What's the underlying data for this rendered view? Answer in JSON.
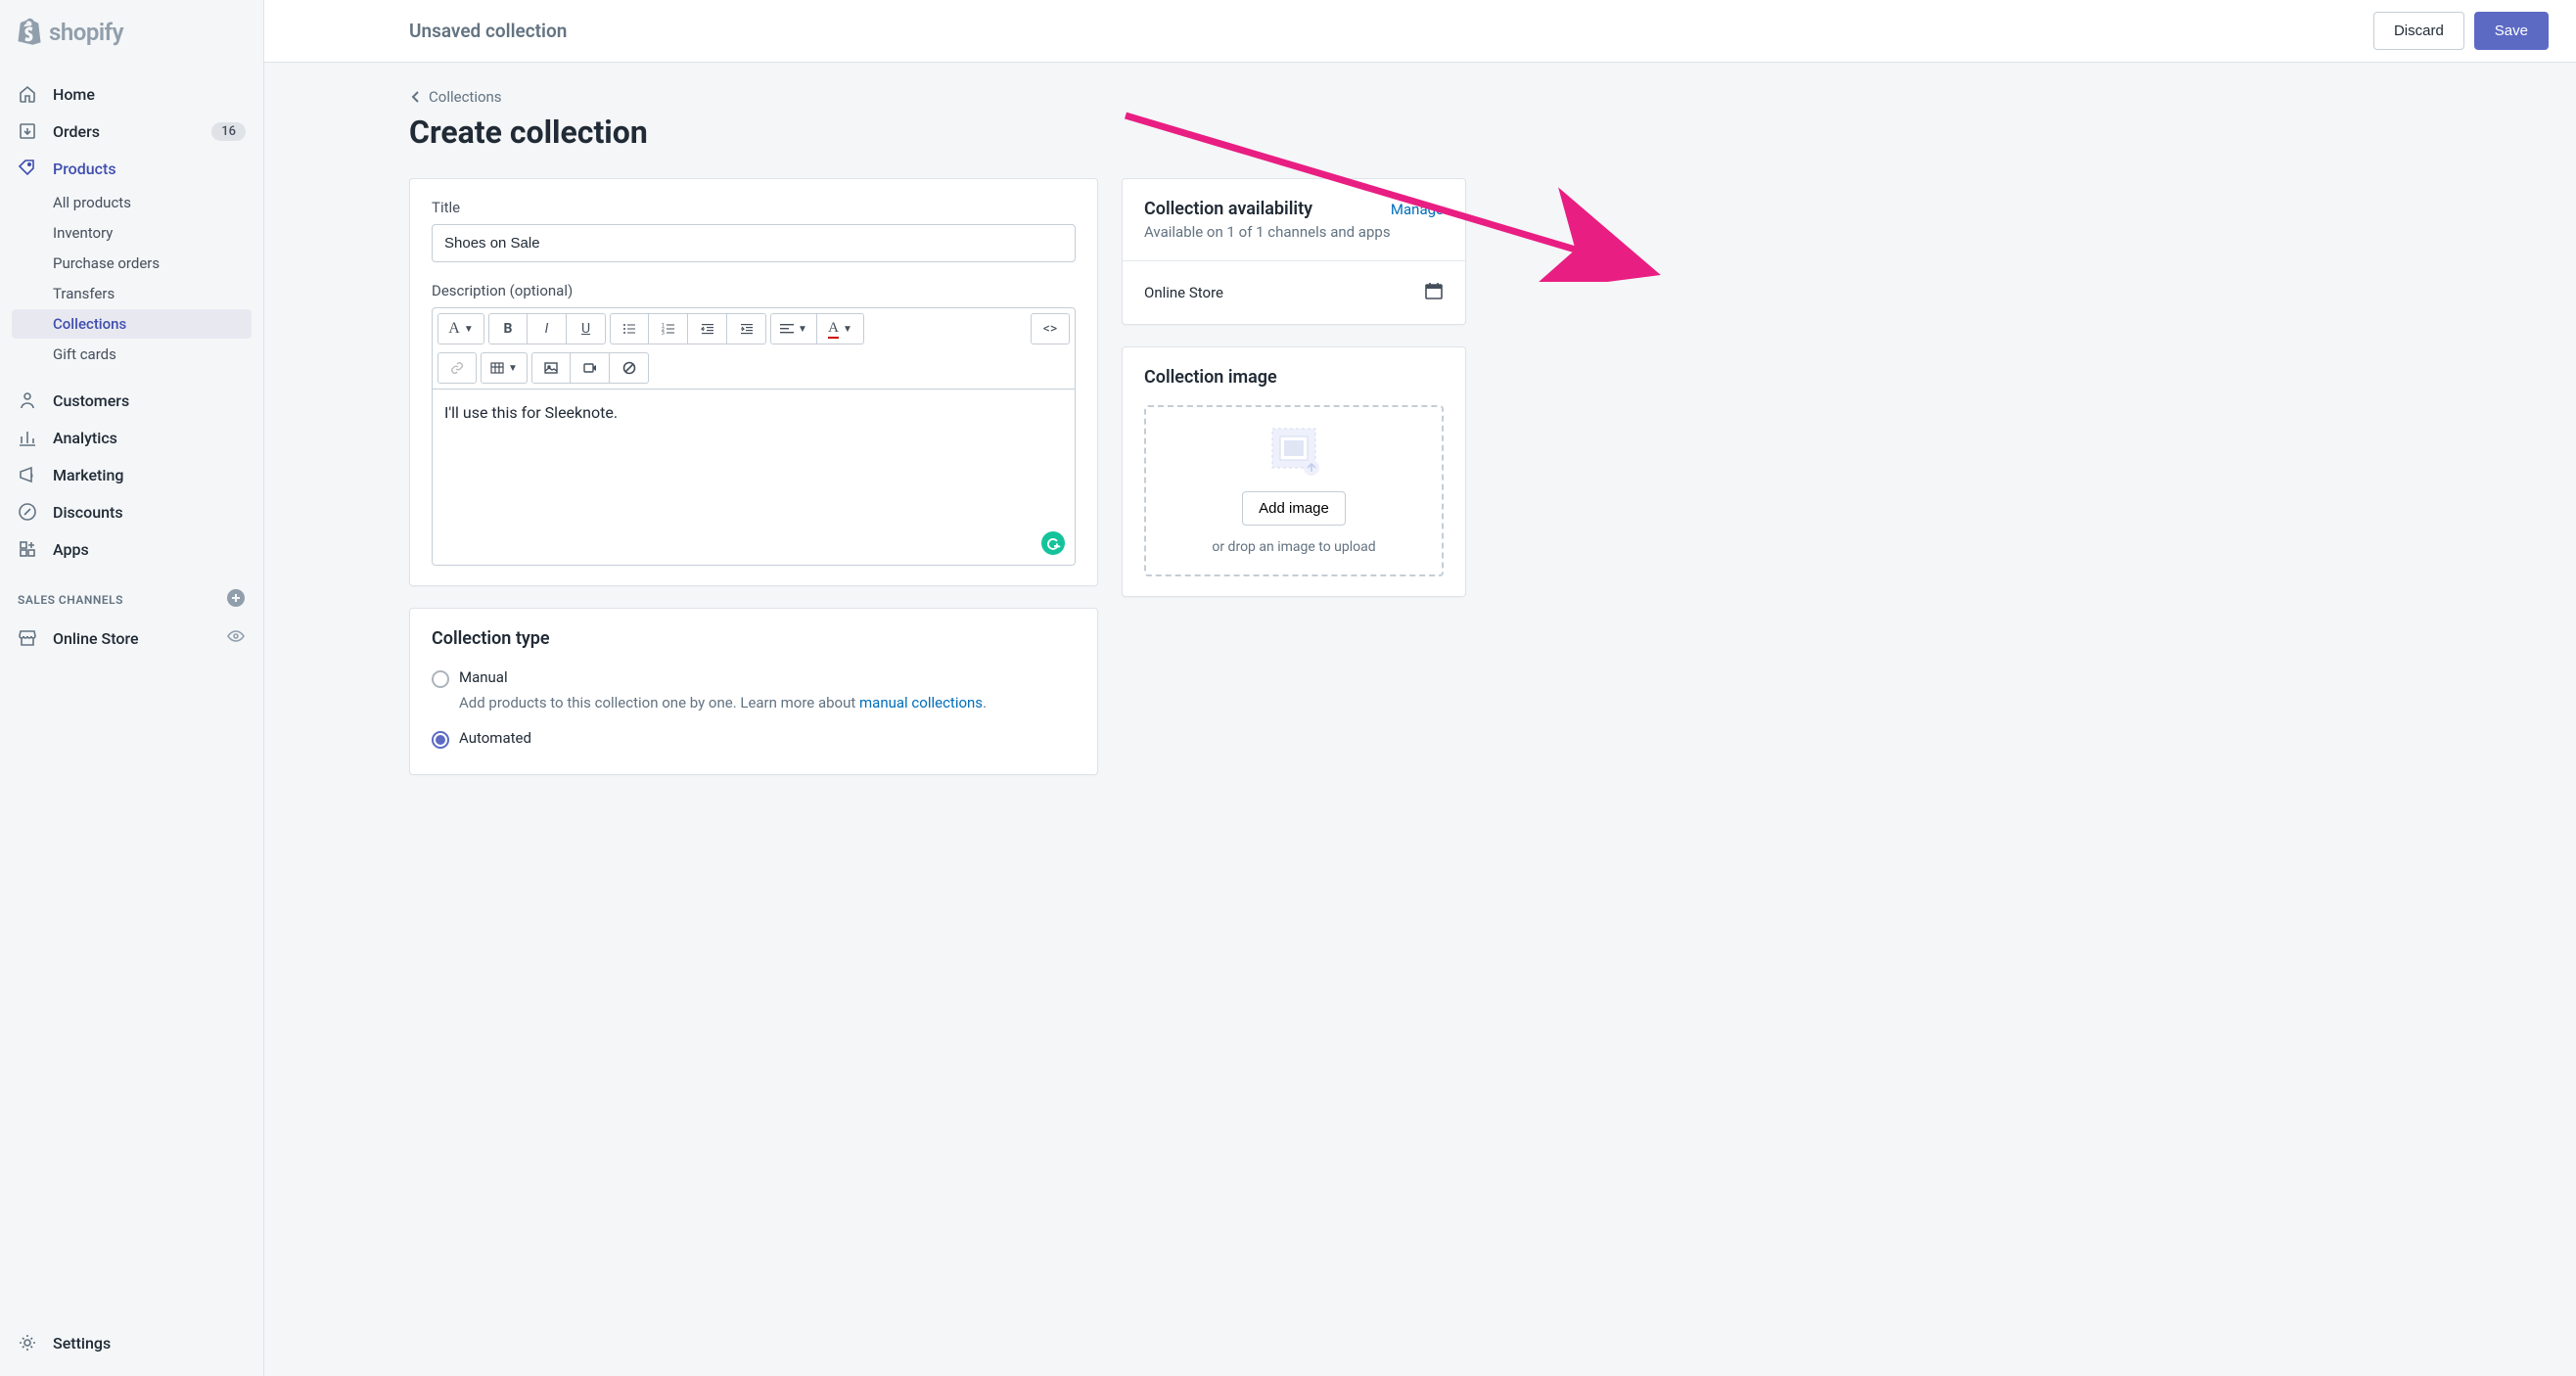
{
  "brand": "shopify",
  "sidebar": {
    "nav": [
      {
        "icon": "home",
        "label": "Home"
      },
      {
        "icon": "orders",
        "label": "Orders",
        "badge": "16"
      },
      {
        "icon": "products",
        "label": "Products",
        "active": true
      }
    ],
    "productSub": [
      {
        "label": "All products"
      },
      {
        "label": "Inventory"
      },
      {
        "label": "Purchase orders"
      },
      {
        "label": "Transfers"
      },
      {
        "label": "Collections",
        "selected": true
      },
      {
        "label": "Gift cards"
      }
    ],
    "nav2": [
      {
        "icon": "customers",
        "label": "Customers"
      },
      {
        "icon": "analytics",
        "label": "Analytics"
      },
      {
        "icon": "marketing",
        "label": "Marketing"
      },
      {
        "icon": "discounts",
        "label": "Discounts"
      },
      {
        "icon": "apps",
        "label": "Apps"
      }
    ],
    "channelsHeader": "SALES CHANNELS",
    "channels": [
      {
        "icon": "store",
        "label": "Online Store"
      }
    ],
    "settingsLabel": "Settings"
  },
  "topbar": {
    "title": "Unsaved collection",
    "discard": "Discard",
    "save": "Save"
  },
  "breadcrumb": "Collections",
  "pageTitle": "Create collection",
  "titleField": {
    "label": "Title",
    "value": "Shoes on Sale"
  },
  "descField": {
    "label": "Description (optional)",
    "value": "I'll use this for Sleeknote."
  },
  "collectionType": {
    "heading": "Collection type",
    "manualLabel": "Manual",
    "manualDesc1": "Add products to this collection one by one. Learn more about ",
    "manualLink": "manual collections",
    "automatedLabel": "Automated"
  },
  "availability": {
    "heading": "Collection availability",
    "manage": "Manage",
    "desc": "Available on 1 of 1 channels and apps",
    "channel": "Online Store"
  },
  "imageCard": {
    "heading": "Collection image",
    "addBtn": "Add image",
    "dropText": "or drop an image to upload"
  }
}
